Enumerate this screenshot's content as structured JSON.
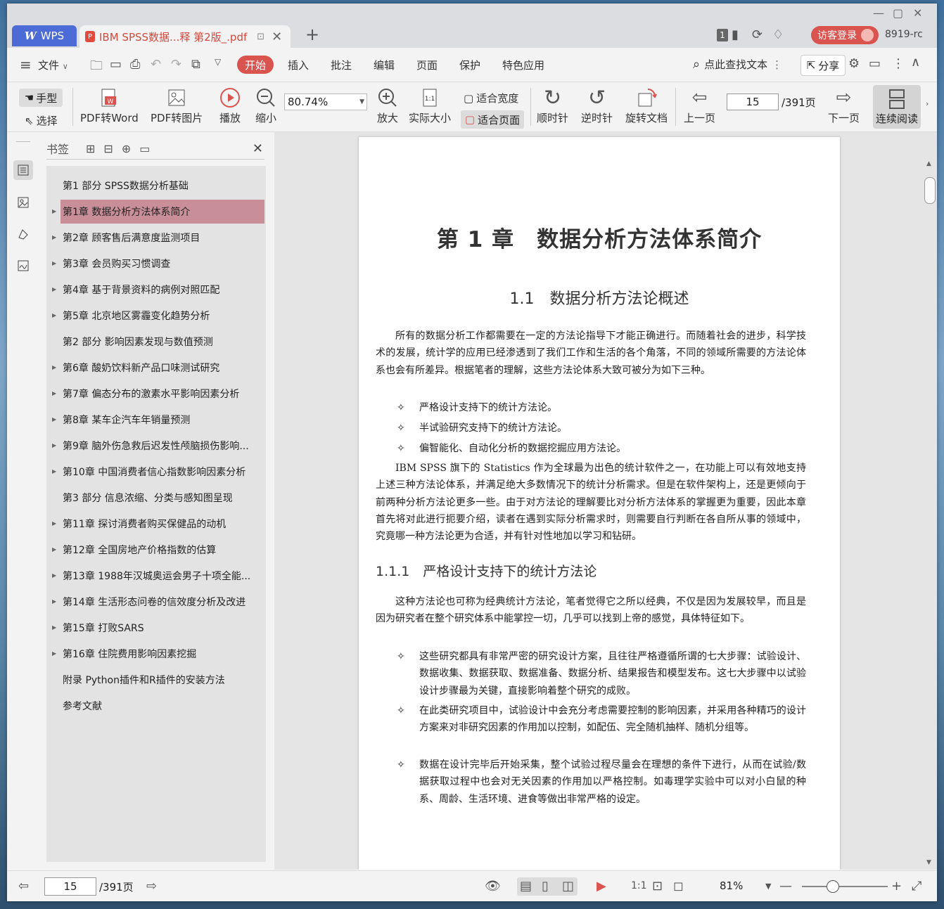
{
  "titlebar": {
    "app_tab": "WPS",
    "doc_tab_title": "IBM SPSS数据...释 第2版_.pdf",
    "tab_count": "1",
    "login_label": "访客登录",
    "user_id": "8919-rc"
  },
  "menu": {
    "items": [
      "文件",
      "开始",
      "插入",
      "批注",
      "编辑",
      "页面",
      "保护",
      "特色应用"
    ],
    "search_label": "点此查找文本",
    "share_label": "分享"
  },
  "ribbon": {
    "hand": "手型",
    "select": "选择",
    "pdf_to_word": "PDF转Word",
    "pdf_to_image": "PDF转图片",
    "play": "播放",
    "zoom_out": "缩小",
    "zoom_value": "80.74%",
    "zoom_in": "放大",
    "actual_size": "实际大小",
    "fit_width": "适合宽度",
    "fit_page": "适合页面",
    "clockwise": "顺时针",
    "counter_clockwise": "逆时针",
    "rotate_doc": "旋转文档",
    "prev_page": "上一页",
    "page_current": "15",
    "page_total": "/391页",
    "next_page": "下一页",
    "continuous_read": "连续阅读"
  },
  "bookmarks": {
    "title": "书签",
    "items": [
      {
        "label": "第1 部分 SPSS数据分析基础",
        "expandable": false,
        "selected": false
      },
      {
        "label": "第1章 数据分析方法体系简介",
        "expandable": true,
        "selected": true
      },
      {
        "label": "第2章 顾客售后满意度监测项目",
        "expandable": true,
        "selected": false
      },
      {
        "label": "第3章 会员购买习惯调查",
        "expandable": true,
        "selected": false
      },
      {
        "label": "第4章 基于背景资料的病例对照匹配",
        "expandable": true,
        "selected": false
      },
      {
        "label": "第5章 北京地区雾霾变化趋势分析",
        "expandable": true,
        "selected": false
      },
      {
        "label": "第2 部分 影响因素发现与数值预测",
        "expandable": false,
        "selected": false
      },
      {
        "label": "第6章 酸奶饮料新产品口味测试研究",
        "expandable": true,
        "selected": false
      },
      {
        "label": "第7章 偏态分布的激素水平影响因素分析",
        "expandable": true,
        "selected": false
      },
      {
        "label": "第8章 某车企汽车年销量预测",
        "expandable": true,
        "selected": false
      },
      {
        "label": "第9章 脑外伤急救后迟发性颅脑损伤影响...",
        "expandable": true,
        "selected": false
      },
      {
        "label": "第10章 中国消费者信心指数影响因素分析",
        "expandable": true,
        "selected": false
      },
      {
        "label": "第3 部分 信息浓缩、分类与感知图呈现",
        "expandable": false,
        "selected": false
      },
      {
        "label": "第11章 探讨消费者购买保健品的动机",
        "expandable": true,
        "selected": false
      },
      {
        "label": "第12章 全国房地产价格指数的估算",
        "expandable": true,
        "selected": false
      },
      {
        "label": "第13章 1988年汉城奥运会男子十项全能...",
        "expandable": true,
        "selected": false
      },
      {
        "label": "第14章 生活形态问卷的信效度分析及改进",
        "expandable": true,
        "selected": false
      },
      {
        "label": "第15章 打败SARS",
        "expandable": true,
        "selected": false
      },
      {
        "label": "第16章 住院费用影响因素挖掘",
        "expandable": true,
        "selected": false
      },
      {
        "label": "附录 Python插件和R插件的安装方法",
        "expandable": false,
        "selected": false
      },
      {
        "label": "参考文献",
        "expandable": false,
        "selected": false
      }
    ]
  },
  "document": {
    "chapter_title": "第 1 章　数据分析方法体系简介",
    "section_title": "1.1　数据分析方法论概述",
    "para1": "所有的数据分析工作都需要在一定的方法论指导下才能正确进行。而随着社会的进步，科学技术的发展，统计学的应用已经渗透到了我们工作和生活的各个角落，不同的领域所需要的方法论体系也会有所差异。根据笔者的理解，这些方法论体系大致可被分为如下三种。",
    "bullets1": [
      "严格设计支持下的统计方法论。",
      "半试验研究支持下的统计方法论。",
      "偏智能化、自动化分析的数据挖掘应用方法论。"
    ],
    "para2": "IBM SPSS 旗下的 Statistics 作为全球最为出色的统计软件之一，在功能上可以有效地支持上述三种方法论体系，并满足绝大多数情况下的统计分析需求。但是在软件架构上，还是更倾向于前两种分析方法论更多一些。由于对方法论的理解要比对分析方法体系的掌握更为重要，因此本章首先将对此进行扼要介绍，读者在遇到实际分析需求时，则需要自行判断在各自所从事的领域中，究竟哪一种方法论更为合适，并有针对性地加以学习和钻研。",
    "subsection_title": "1.1.1　严格设计支持下的统计方法论",
    "para3": "这种方法论也可称为经典统计方法论，笔者觉得它之所以经典，不仅是因为发展较早，而且是因为研究者在整个研究体系中能掌控一切，几乎可以找到上帝的感觉，具体特征如下。",
    "bullets2": [
      "这些研究都具有非常严密的研究设计方案，且往往严格遵循所谓的七大步骤：试验设计、数据收集、数据获取、数据准备、数据分析、结果报告和模型发布。这七大步骤中以试验设计步骤最为关键，直接影响着整个研究的成败。",
      "在此类研究项目中，试验设计中会充分考虑需要控制的影响因素，并采用各种精巧的设计方案来对非研究因素的作用加以控制，如配伍、完全随机抽样、随机分组等。",
      "数据在设计完毕后开始采集，整个试验过程尽量会在理想的条件下进行，从而在试验/数据获取过程中也会对无关因素的作用加以严格控制。如毒理学实验中可以对小白鼠的种系、周龄、生活环境、进食等做出非常严格的设定。"
    ]
  },
  "statusbar": {
    "page_current": "15",
    "page_total": "/391页",
    "zoom_percent": "81%",
    "zoom_level": 0.35
  },
  "colors": {
    "accent_red": "#d9534f",
    "wps_blue": "#4d6bd6",
    "bookmark_selected": "#c98f98"
  }
}
